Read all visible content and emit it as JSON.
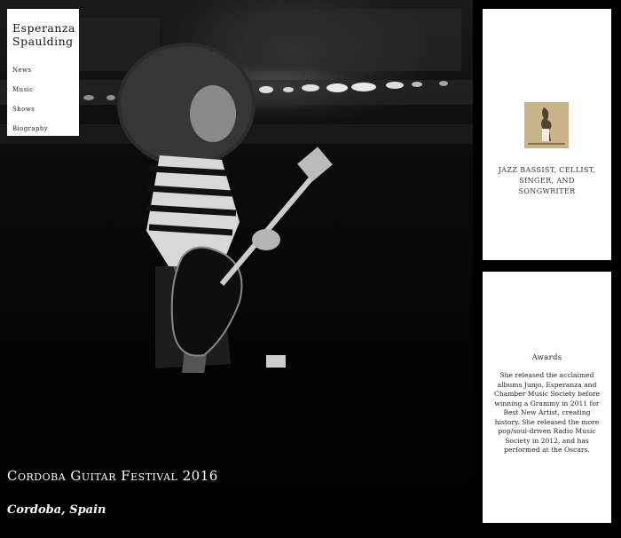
{
  "site": {
    "title_line1": "Esperanza",
    "title_line2": "Spaulding"
  },
  "nav": {
    "items": [
      {
        "label": "News"
      },
      {
        "label": "Music"
      },
      {
        "label": "Shows"
      },
      {
        "label": "Biography"
      }
    ]
  },
  "hero": {
    "caption_title": "Cordoba Guitar Festival 2016",
    "caption_location": "Cordoba, Spain"
  },
  "profile_card": {
    "tagline": "Jazz bassist, cellist, singer, and songwriter"
  },
  "awards_card": {
    "title": "Awards",
    "text": "She released the acclaimed albums Junjo, Esperanza and Chamber Music Society before winning a Grammy in 2011 for Best New Artist, creating history. She released the more pop/soul-driven Radio Music Society in 2012, and has performed at the Oscars."
  },
  "colors": {
    "background": "#000000",
    "card": "#ffffff",
    "logo_tan": "#c9b48a"
  }
}
